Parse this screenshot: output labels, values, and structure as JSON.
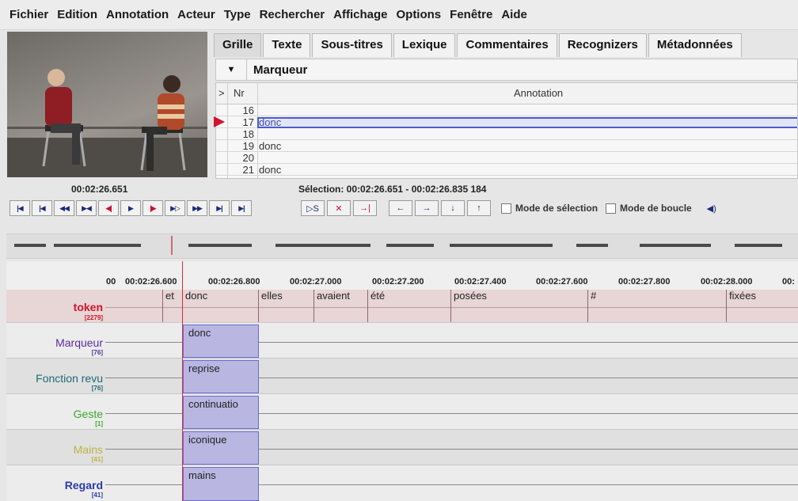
{
  "menu": [
    "Fichier",
    "Edition",
    "Annotation",
    "Acteur",
    "Type",
    "Rechercher",
    "Affichage",
    "Options",
    "Fenêtre",
    "Aide"
  ],
  "tabs": [
    "Grille",
    "Texte",
    "Sous-titres",
    "Lexique",
    "Commentaires",
    "Recognizers",
    "Métadonnées"
  ],
  "tier_selector": {
    "value": "Marqueur",
    "arrow": "▼"
  },
  "grid": {
    "col_marker": ">",
    "col_nr": "Nr",
    "col_annotation": "Annotation",
    "rows": [
      {
        "nr": "16",
        "annotation": ""
      },
      {
        "nr": "17",
        "annotation": "donc"
      },
      {
        "nr": "18",
        "annotation": ""
      },
      {
        "nr": "19",
        "annotation": "donc"
      },
      {
        "nr": "20",
        "annotation": ""
      },
      {
        "nr": "21",
        "annotation": "donc"
      }
    ]
  },
  "media_time": "00:02:26.651",
  "selection": "Sélection: 00:02:26.651 - 00:02:26.835  184",
  "player": {
    "mode_selection": "Mode de sélection",
    "mode_loop": "Mode de boucle"
  },
  "ruler_ticks": [
    "00",
    "00:02:26.600",
    "00:02:26.800",
    "00:02:27.000",
    "00:02:27.200",
    "00:02:27.400",
    "00:02:27.600",
    "00:02:27.800",
    "00:02:28.000",
    "00:"
  ],
  "tiers": [
    {
      "name": "token",
      "count": "[2279]",
      "color": "#d0142c",
      "bold": true
    },
    {
      "name": "Marqueur",
      "count": "[76]",
      "color": "#5a2d9a",
      "bold": false
    },
    {
      "name": "Fonction revu",
      "count": "[76]",
      "color": "#1d6b72",
      "bold": false
    },
    {
      "name": "Geste",
      "count": "[1]",
      "color": "#3aa82a",
      "bold": false
    },
    {
      "name": "Mains",
      "count": "[41]",
      "color": "#c1b045",
      "bold": false
    },
    {
      "name": "Regard",
      "count": "[41]",
      "color": "#2a3aa8",
      "bold": false
    }
  ],
  "tokens": [
    "et",
    "donc",
    "elles",
    "avaient",
    "été",
    "posées",
    "#",
    "fixées"
  ],
  "annotations": [
    "donc",
    "reprise",
    "continuatio",
    "iconique",
    "mains"
  ]
}
